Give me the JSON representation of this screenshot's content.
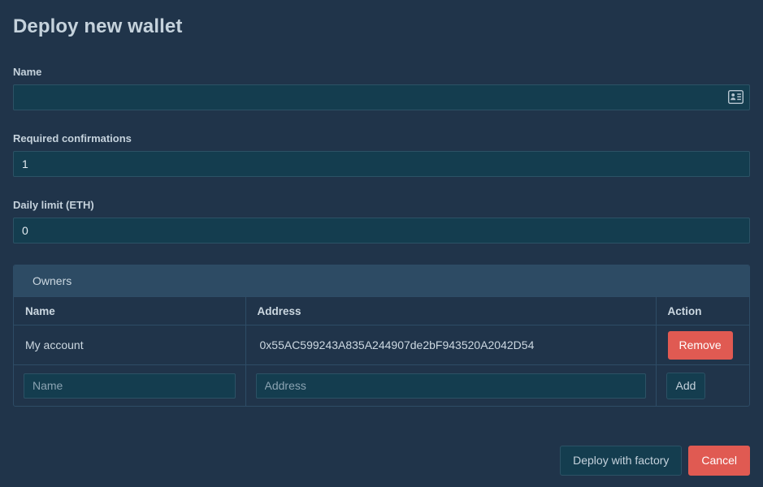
{
  "page": {
    "title": "Deploy new wallet",
    "accent_red": "#e05a52",
    "background": "#20344a",
    "input_background": "#143d4f",
    "panel_header_background": "#2d4b64"
  },
  "form": {
    "name": {
      "label": "Name",
      "value": "",
      "placeholder": "",
      "icon": "address-book-icon"
    },
    "required_confirmations": {
      "label": "Required confirmations",
      "value": "1",
      "placeholder": ""
    },
    "daily_limit": {
      "label": "Daily limit (ETH)",
      "value": "0",
      "placeholder": ""
    }
  },
  "owners": {
    "panel_title": "Owners",
    "columns": [
      "Name",
      "Address",
      "Action"
    ],
    "rows": [
      {
        "name": "My account",
        "address": "0x55AC599243A835A244907de2bF943520A2042D54",
        "action_label": "Remove"
      }
    ],
    "add_row": {
      "name_value": "",
      "name_placeholder": "Name",
      "address_value": "",
      "address_placeholder": "Address",
      "action_label": "Add"
    }
  },
  "footer": {
    "deploy_label": "Deploy with factory",
    "cancel_label": "Cancel"
  }
}
